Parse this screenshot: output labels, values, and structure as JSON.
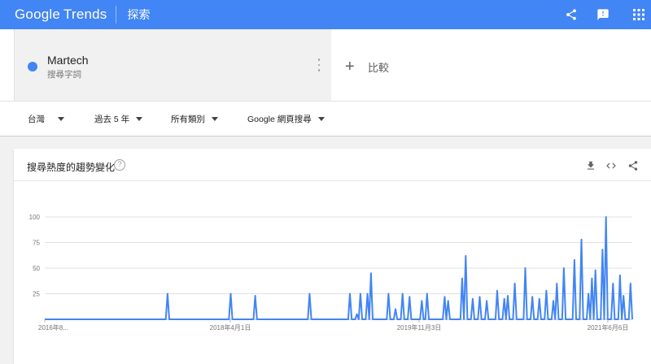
{
  "header": {
    "logo_google": "Google",
    "logo_trends": "Trends",
    "section_title": "探索",
    "icons": [
      "share-icon",
      "feedback-icon",
      "apps-grid-icon"
    ]
  },
  "term": {
    "name": "Martech",
    "type": "搜尋字詞",
    "color": "#4285f4"
  },
  "compare": {
    "label": "比較"
  },
  "filters": {
    "region": "台灣",
    "time": "過去 5 年",
    "category": "所有類別",
    "property": "Google 網頁搜尋"
  },
  "card": {
    "title": "搜尋熱度的趨勢變化",
    "help": "?",
    "icons": [
      "download-icon",
      "embed-code-icon",
      "share-icon"
    ]
  },
  "colors": {
    "brand": "#4285f4",
    "line": "#4285f4",
    "grid": "#e0e0e0"
  },
  "chart_data": {
    "type": "line",
    "title": "",
    "xlabel": "",
    "ylabel": "",
    "ylim": [
      0,
      100
    ],
    "yticks": [
      25,
      50,
      75,
      100
    ],
    "xtick_labels": [
      "2016年8...",
      "2018年4月1日",
      "2019年11月3日",
      "2021年6月6日"
    ],
    "grid": true,
    "series": [
      {
        "values": [
          0,
          0,
          0,
          0,
          0,
          0,
          0,
          0,
          0,
          0,
          0,
          0,
          0,
          0,
          0,
          0,
          0,
          0,
          0,
          0,
          0,
          0,
          0,
          0,
          0,
          0,
          0,
          0,
          0,
          0,
          0,
          0,
          0,
          0,
          0,
          0,
          0,
          0,
          0,
          0,
          0,
          0,
          0,
          0,
          0,
          0,
          0,
          0,
          0,
          0,
          0,
          0,
          0,
          0,
          0,
          0,
          0,
          0,
          0,
          0,
          0,
          0,
          0,
          0,
          0,
          0,
          0,
          0,
          0,
          0,
          0,
          0,
          0,
          0,
          0,
          0,
          0,
          0,
          0,
          0,
          0,
          0,
          0,
          0,
          0,
          0,
          0,
          0,
          0,
          0,
          0,
          0,
          0,
          0,
          0,
          0,
          0,
          0,
          0,
          0,
          0,
          0,
          0,
          0,
          0,
          0,
          0,
          0,
          0,
          0,
          0,
          0,
          0,
          0,
          0,
          0,
          0,
          0,
          0,
          0,
          0,
          0,
          0,
          0,
          0,
          0,
          0,
          0,
          0,
          0,
          0,
          0,
          0,
          0,
          0,
          0,
          0,
          0,
          0,
          0,
          0,
          0,
          0,
          0,
          0,
          0,
          0,
          0,
          0,
          0,
          0,
          0,
          0,
          0,
          0,
          0,
          0,
          0,
          0,
          0,
          0,
          0,
          0,
          0,
          0,
          0,
          0,
          0,
          0,
          0,
          0,
          0,
          0,
          0,
          0,
          0,
          0,
          0,
          0,
          0,
          0,
          0,
          0,
          0,
          0,
          0,
          0,
          0,
          0,
          0,
          0,
          0,
          0,
          0,
          0,
          0,
          0,
          0,
          0,
          0,
          0,
          0,
          0,
          0,
          0,
          0,
          0,
          0,
          0,
          0,
          0,
          0,
          0,
          0,
          0,
          0,
          0,
          0,
          0,
          0,
          0,
          0,
          0,
          0,
          0,
          0,
          0,
          0,
          0,
          0,
          0,
          0,
          0,
          0,
          0,
          0,
          0,
          0,
          0,
          0,
          0,
          0,
          0,
          0,
          0,
          0,
          0,
          0,
          0,
          0,
          0,
          0,
          0,
          0,
          0,
          0,
          0,
          0,
          0,
          0,
          0,
          0,
          0,
          0,
          0,
          0,
          0,
          0,
          0,
          0,
          0,
          0,
          0,
          0,
          0,
          0,
          0,
          0,
          0,
          0,
          0,
          0,
          0,
          0,
          0,
          0,
          0,
          0,
          0,
          0,
          0,
          0,
          0,
          0,
          0,
          0,
          0,
          0,
          0,
          0,
          0,
          0,
          0,
          0,
          0,
          0,
          0,
          0,
          0,
          0,
          0,
          0,
          0,
          0,
          0,
          0,
          0,
          0,
          0,
          0,
          0,
          0,
          0,
          0,
          0,
          0,
          0,
          0,
          0,
          0,
          0,
          0,
          0,
          0,
          0,
          0
        ]
      }
    ]
  }
}
